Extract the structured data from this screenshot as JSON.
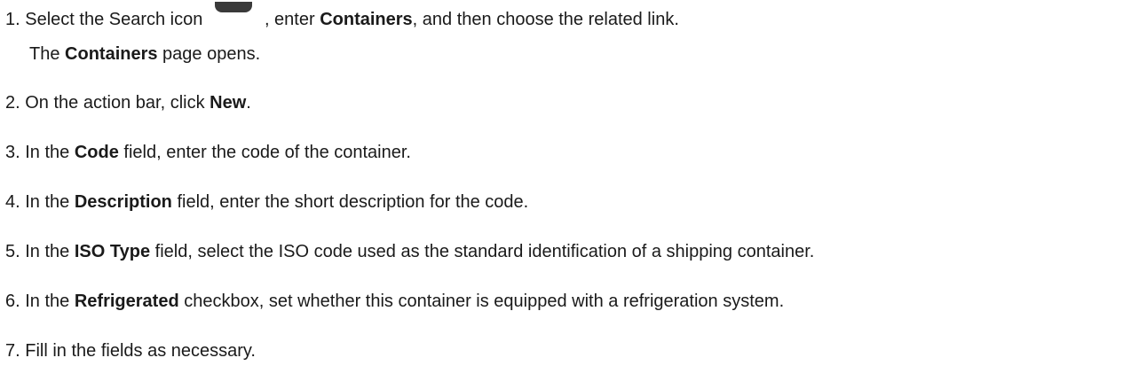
{
  "steps": [
    {
      "num": "1.",
      "pre": "Select the Search icon",
      "icon": "search-icon",
      "mid": ", enter ",
      "bold1": "Containers",
      "post": ", and then choose the related link.",
      "sub_pre": "The ",
      "sub_bold": "Containers",
      "sub_post": " page opens."
    },
    {
      "num": "2.",
      "pre": "On the action bar, click ",
      "bold": "New",
      "post": "."
    },
    {
      "num": "3.",
      "pre": "In the ",
      "bold": "Code",
      "post": " field, enter the code of the container."
    },
    {
      "num": "4.",
      "pre": "In the ",
      "bold": "Description",
      "post": " field, enter the short description for the code."
    },
    {
      "num": "5.",
      "pre": "In the ",
      "bold": "ISO Type",
      "post": " field, select the ISO code used as the standard identification of a shipping container."
    },
    {
      "num": "6.",
      "pre": "In the ",
      "bold": "Refrigerated",
      "post": " checkbox, set whether this container is equipped with a refrigeration system."
    },
    {
      "num": "7.",
      "pre": "Fill in the fields as necessary."
    }
  ]
}
